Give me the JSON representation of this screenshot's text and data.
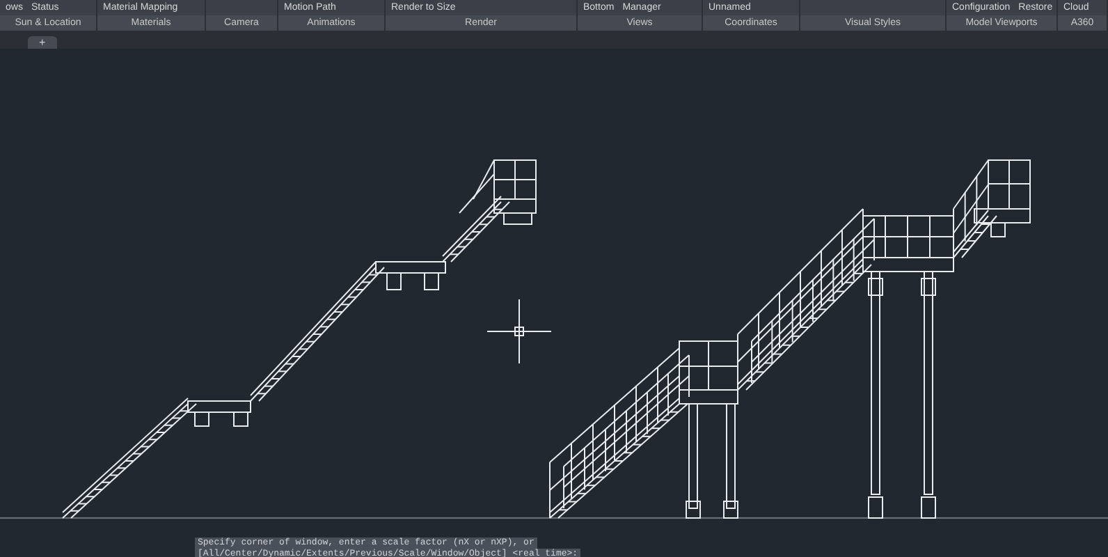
{
  "ribbon": {
    "panels": [
      {
        "items": [
          "ows",
          "Status"
        ],
        "label": "Sun & Location"
      },
      {
        "items": [
          "Material Mapping"
        ],
        "label": "Materials"
      },
      {
        "label": "Camera"
      },
      {
        "items": [
          "Motion Path"
        ],
        "label": "Animations"
      },
      {
        "items": [
          "Render to Size"
        ],
        "label": "Render"
      },
      {
        "items": [
          "Bottom",
          "Manager"
        ],
        "label": "Views"
      },
      {
        "items": [
          "Unnamed"
        ],
        "label": "Coordinates"
      },
      {
        "label": "Visual Styles"
      },
      {
        "items": [
          "Configuration",
          "Restore"
        ],
        "label": "Model Viewports"
      },
      {
        "items": [
          "Cloud"
        ],
        "label": "A360"
      }
    ]
  },
  "tabs": [
    {
      "label": "+"
    }
  ],
  "command_line": {
    "lines": [
      "Specify corner of window, enter a scale factor (nX or nXP), or",
      "[All/Center/Dynamic/Extents/Previous/Scale/Window/Object] <real time>:"
    ]
  }
}
